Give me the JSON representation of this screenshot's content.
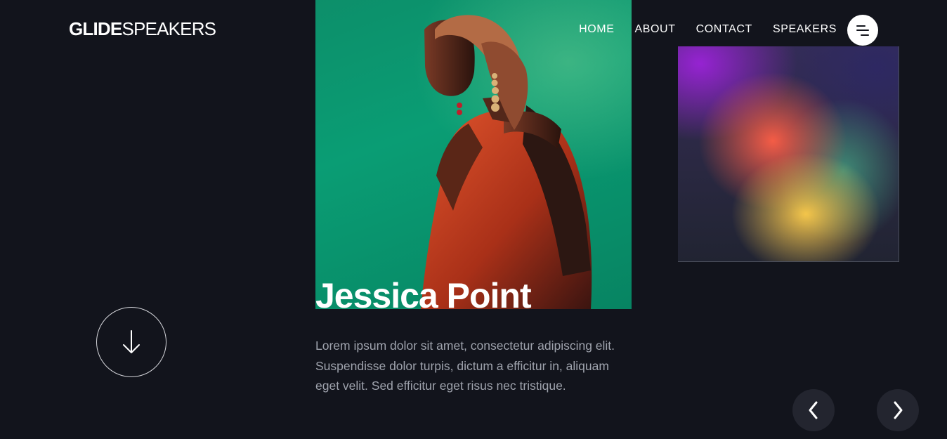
{
  "header": {
    "logo": {
      "strong": "GLIDE",
      "light": "SPEAKERS"
    },
    "nav": [
      {
        "label": "HOME"
      },
      {
        "label": "ABOUT"
      },
      {
        "label": "CONTACT"
      },
      {
        "label": "SPEAKERS"
      }
    ],
    "menu_icon": "hamburger-menu-icon"
  },
  "speaker": {
    "name": "Jessica Point",
    "bio": "Lorem ipsum dolor sit amet, consectetur adipiscing elit. Suspendisse dolor turpis, dictum a efficitur in, aliquam eget velit. Sed efficitur eget risus nec tristique."
  },
  "controls": {
    "scroll_icon": "arrow-down-icon",
    "prev_icon": "chevron-left-icon",
    "next_icon": "chevron-right-icon"
  },
  "colors": {
    "background": "#12141c",
    "text": "#ffffff",
    "bio_text": "#9fa3ad",
    "photo_bg": "#0a9d74",
    "control_bg": "#23252f"
  }
}
